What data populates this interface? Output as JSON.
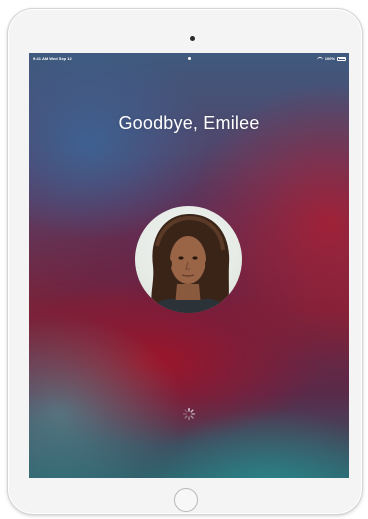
{
  "device": {
    "type": "iPad",
    "colors": {
      "frame": "#f4f4f5",
      "home_ring": "#b8b8bc"
    }
  },
  "status_bar": {
    "time_date": "9:41 AM  Wed Sep 12",
    "battery": "100%"
  },
  "lock_screen": {
    "greeting": "Goodbye, Emilee",
    "avatar_icon": "user-photo",
    "activity_icon": "spinner-icon"
  }
}
